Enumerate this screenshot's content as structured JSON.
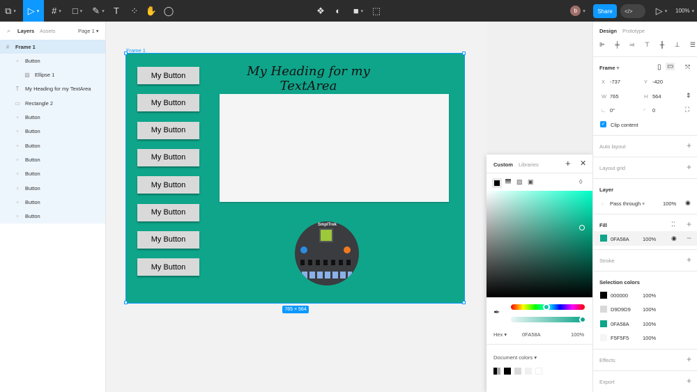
{
  "toolbar": {
    "share": "Share",
    "zoom": "100%",
    "avatar": "b"
  },
  "layers": {
    "tab_layers": "Layers",
    "tab_assets": "Assets",
    "page": "Page 1",
    "items": [
      {
        "label": "Frame 1",
        "icon": "#"
      },
      {
        "label": "Button",
        "icon": "▫"
      },
      {
        "label": "Ellipse 1",
        "icon": "▨"
      },
      {
        "label": "My Heading for my TextArea",
        "icon": "T"
      },
      {
        "label": "Rectangle 2",
        "icon": "▭"
      },
      {
        "label": "Button",
        "icon": "▫"
      },
      {
        "label": "Button",
        "icon": "▫"
      },
      {
        "label": "Button",
        "icon": "▫"
      },
      {
        "label": "Button",
        "icon": "▫"
      },
      {
        "label": "Button",
        "icon": "▫"
      },
      {
        "label": "Button",
        "icon": "▫"
      },
      {
        "label": "Button",
        "icon": "▫"
      },
      {
        "label": "Button",
        "icon": "▫"
      }
    ]
  },
  "canvas": {
    "frame_label": "Frame 1",
    "size_label": "765 × 564",
    "heading": "My Heading for my TextArea",
    "image_text": "SmplTrek",
    "buttons": [
      "My Button",
      "My Button",
      "My Button",
      "My Button",
      "My Button",
      "My Button",
      "My Button",
      "My Button"
    ],
    "frame_color": "#0FA58A"
  },
  "picker": {
    "tab_custom": "Custom",
    "tab_libraries": "Libraries",
    "hex_label": "Hex",
    "hex": "0FA58A",
    "opacity": "100%",
    "doc_colors": "Document colors"
  },
  "design": {
    "tab_design": "Design",
    "tab_prototype": "Prototype",
    "frame": "Frame",
    "x_label": "X",
    "x": "-737",
    "y_label": "Y",
    "y": "-420",
    "w_label": "W",
    "w": "765",
    "h_label": "H",
    "h": "564",
    "rotation": "0°",
    "radius": "0",
    "clip": "Clip content",
    "auto_layout": "Auto layout",
    "layout_grid": "Layout grid",
    "layer": "Layer",
    "blend": "Pass through",
    "layer_opacity": "100%",
    "fill": "Fill",
    "fill_hex": "0FA58A",
    "fill_opacity": "100%",
    "stroke": "Stroke",
    "selection_colors": "Selection colors",
    "colors": [
      {
        "hex": "000000",
        "op": "100%",
        "c": "#000000"
      },
      {
        "hex": "D9D9D9",
        "op": "100%",
        "c": "#D9D9D9"
      },
      {
        "hex": "0FA58A",
        "op": "100%",
        "c": "#0FA58A"
      },
      {
        "hex": "F5F5F5",
        "op": "100%",
        "c": "#F5F5F5"
      }
    ],
    "effects": "Effects",
    "export": "Export"
  }
}
